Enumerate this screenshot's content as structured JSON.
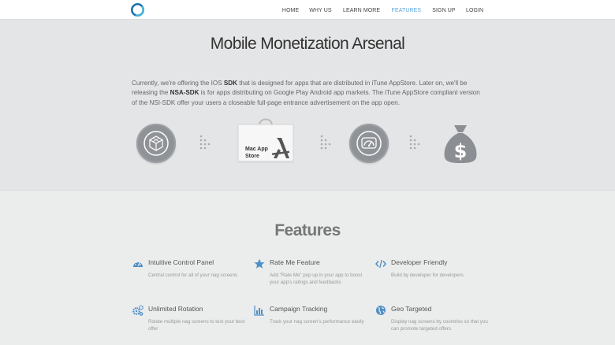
{
  "nav": {
    "items": [
      {
        "label": "HOME",
        "active": false
      },
      {
        "label": "WHY US",
        "active": false
      },
      {
        "label": "LEARN MORE",
        "active": false
      },
      {
        "label": "FEATURES",
        "active": true
      },
      {
        "label": "SIGN UP",
        "active": false
      },
      {
        "label": "LOGIN",
        "active": false
      }
    ],
    "active_color": "#5ea6dd"
  },
  "hero": {
    "title": "Mobile Monetization Arsenal",
    "paragraph": {
      "p1": "Currently, we're offering the IOS ",
      "b1": "SDK",
      "p2": " that is designed for apps that are distributed in iTune AppStore. Later on, we'll be releasing the ",
      "b2": "NSA-SDK",
      "p3": " is for apps distributing on Google Play Android app markets. The iTune AppStore compliant version of the NSI-SDK offer your users a closeable full-page entrance advertisement on the app open."
    },
    "flow": {
      "store_label_line1": "Mac App",
      "store_label_line2": "Store",
      "icons": [
        "sdk-cube-icon",
        "mac-app-store-bag-icon",
        "speedometer-icon",
        "money-bag-icon"
      ]
    }
  },
  "features": {
    "title": "Features",
    "icon_color": "#4d8fc7",
    "items": [
      {
        "icon": "dashboard-icon",
        "title": "Intuitive Control Panel",
        "desc": "Central control for all of your nag screens"
      },
      {
        "icon": "star-icon",
        "title": "Rate Me Feature",
        "desc": "Add \"Rate Me\" pop up in your app to boost your app's ratings and feedbacks"
      },
      {
        "icon": "code-icon",
        "title": "Developer Friendly",
        "desc": "Build by developer for developers"
      },
      {
        "icon": "gears-icon",
        "title": "Unlimited Rotation",
        "desc": "Rotate multiple nag screens to test your best offer"
      },
      {
        "icon": "bar-chart-icon",
        "title": "Campaign Tracking",
        "desc": "Track your nag screen's performance easily"
      },
      {
        "icon": "globe-icon",
        "title": "Geo Targeted",
        "desc": "Display nag screens by countries so that you can promote targeted offers."
      }
    ]
  }
}
